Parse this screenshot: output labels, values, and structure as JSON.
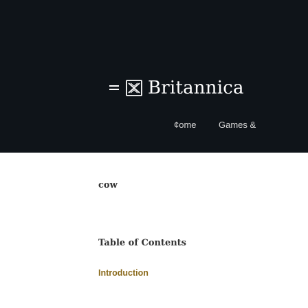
{
  "header": {
    "brand": "Britannica",
    "menu_icon": "hamburger-menu-icon",
    "emblem_icon": "britannica-thistle-logo-icon",
    "background_color": "#0f1419"
  },
  "nav": {
    "items": [
      "¢ome",
      "Games &"
    ]
  },
  "article": {
    "topic": "cow",
    "toc_heading": "Table of Contents",
    "toc_items": [
      "Introduction"
    ],
    "link_color": "#8a6a1c"
  }
}
